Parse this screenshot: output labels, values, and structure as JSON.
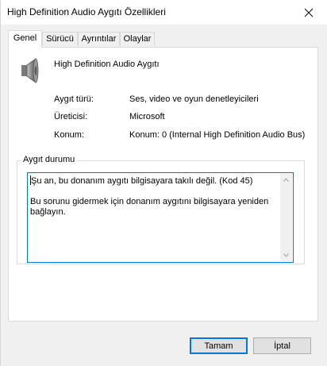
{
  "window": {
    "title": "High Definition Audio Aygıtı Özellikleri"
  },
  "tabs": [
    {
      "label": "Genel",
      "active": true
    },
    {
      "label": "Sürücü",
      "active": false
    },
    {
      "label": "Ayrıntılar",
      "active": false
    },
    {
      "label": "Olaylar",
      "active": false
    }
  ],
  "device": {
    "name": "High Definition Audio Aygıtı",
    "icon": "speaker-icon",
    "properties": [
      {
        "label": "Aygıt türü:",
        "value": "Ses, video ve oyun denetleyicileri"
      },
      {
        "label": "Üreticisi:",
        "value": "Microsoft"
      },
      {
        "label": "Konum:",
        "value": "Konum: 0 (Internal High Definition Audio Bus)"
      }
    ]
  },
  "status": {
    "group_title": "Aygıt durumu",
    "line1": "Şu an, bu donanım aygıtı bilgisayara takılı değil. (Kod 45)",
    "line2": "Bu sorunu gidermek için donanım aygıtını bilgisayara yeniden bağlayın."
  },
  "buttons": {
    "ok": "Tamam",
    "cancel": "İptal"
  },
  "colors": {
    "accent": "#0078d7",
    "window_bg": "#f0f0f0",
    "panel_bg": "#ffffff"
  }
}
